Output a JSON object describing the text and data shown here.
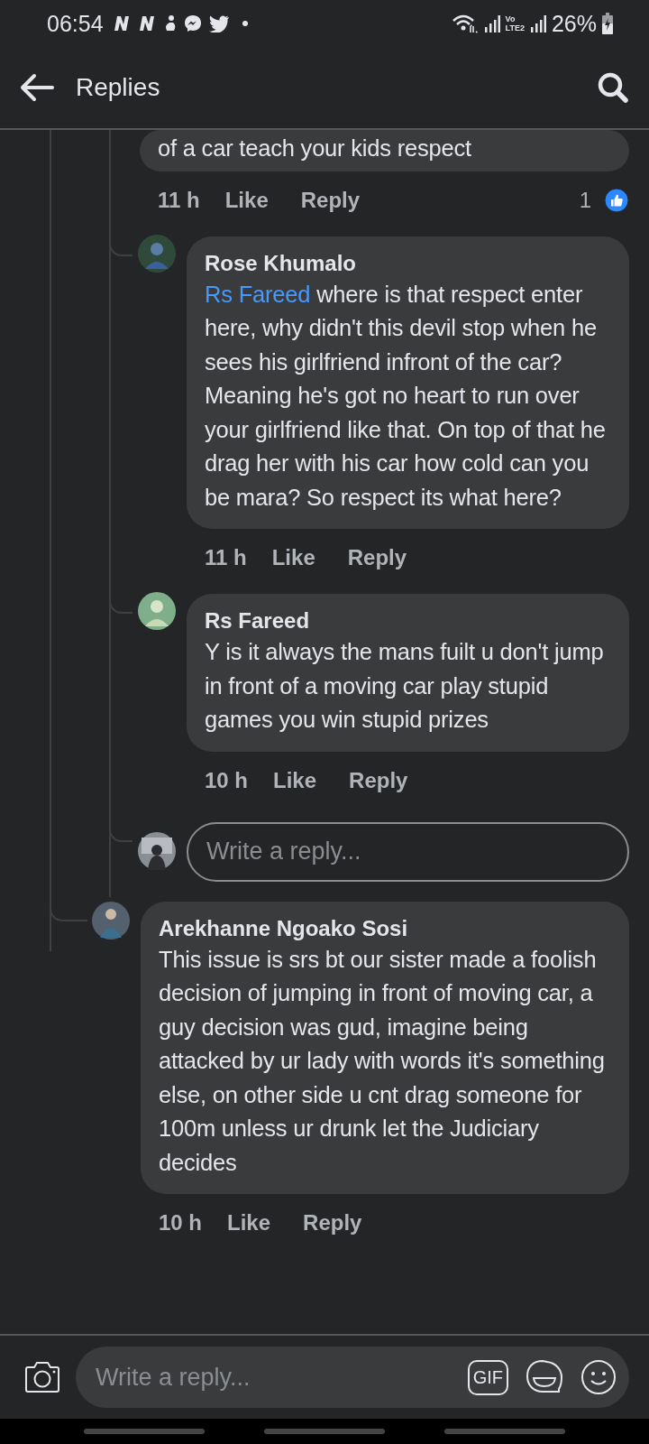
{
  "status_bar": {
    "time": "06:54",
    "volte": [
      "Vo",
      "LTE2"
    ],
    "battery": "26%"
  },
  "header": {
    "title": "Replies"
  },
  "top_comment": {
    "text": "of a car teach your kids respect",
    "time": "11 h",
    "like": "Like",
    "reply": "Reply",
    "liked": false,
    "reaction_count": "1"
  },
  "replies": [
    {
      "author": "Rose Khumalo",
      "mention": "Rs Fareed",
      "text": "where is that  respect enter here, why didn't this devil stop when he sees his girlfriend infront of the car? Meaning he's got no heart to run over your girlfriend like that. On top of that he drag her with his car how cold can you be mara? So respect its what here?",
      "time": "11 h",
      "like": "Like",
      "reply": "Reply",
      "liked": false
    },
    {
      "author": "Rs Fareed",
      "text": "Y is it always the mans fuilt u don't jump in front of a moving car play stupid games you win stupid prizes",
      "time": "10 h",
      "like": "Like",
      "reply": "Reply",
      "liked": false
    }
  ],
  "reply_box": {
    "placeholder": "Write a reply..."
  },
  "next_comment": {
    "author": "Arekhanne Ngoako Sosi",
    "text": "This issue is srs bt our sister made a foolish decision of jumping in front of moving car, a guy decision was gud, imagine being attacked by ur lady with words it's something else, on other side u cnt drag someone for 100m unless ur drunk let the Judiciary decides",
    "time": "10 h",
    "like": "Like",
    "reply": "Reply",
    "liked": false
  },
  "composer": {
    "placeholder": "Write a reply...",
    "gif": "GIF"
  }
}
